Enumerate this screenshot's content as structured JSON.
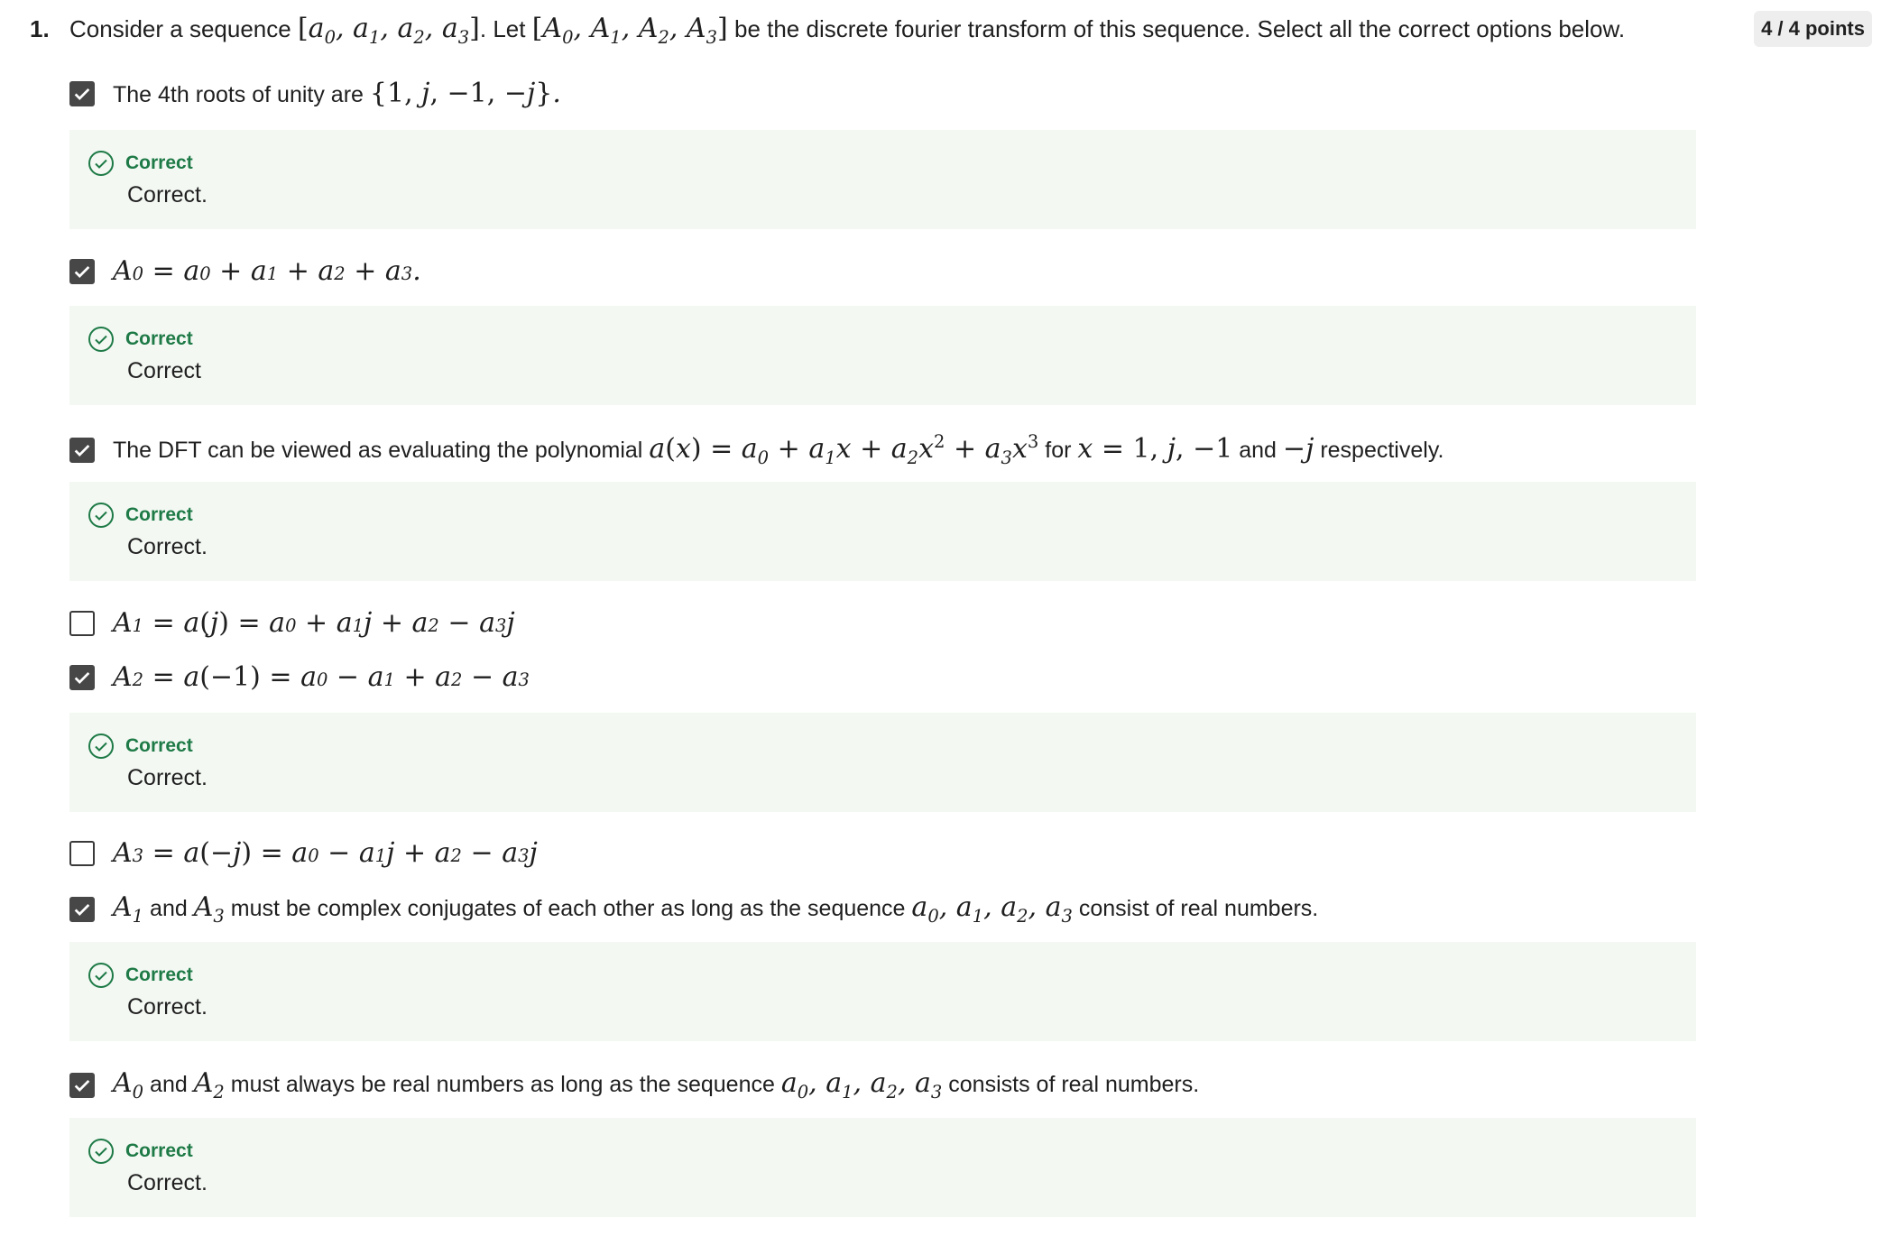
{
  "question": {
    "number": "1.",
    "intro": "Consider a sequence",
    "seq": "[a0, a1, a2, a3]",
    "mid": ". Let",
    "dft": "[A0, A1, A2, A3]",
    "tail": "be the discrete fourier transform of this sequence. Select all the correct options below."
  },
  "points": "4 / 4 points",
  "options": [
    {
      "text": "The 4th roots of unity are",
      "math": "{1, j, −1, −j}.",
      "checked": true
    },
    {
      "math": "A0 = a0 + a1 + a2 + a3.",
      "checked": true
    },
    {
      "text": "The DFT can be viewed as evaluating the polynomial",
      "math": "a(x) = a0 + a1x + a2x² + a3x³",
      "text2": "for",
      "math2": "x = 1, j, −1",
      "text3": "and",
      "math3": "−j",
      "text4": "respectively.",
      "checked": true
    },
    {
      "math": "A1 = a(j) = a0 + a1j + a2 − a3j",
      "checked": false
    },
    {
      "math": "A2 = a(−1) = a0 − a1 + a2 − a3",
      "checked": true
    },
    {
      "math": "A3 = a(−j) = a0 − a1j + a2 − a3j",
      "checked": false
    },
    {
      "math": "A1",
      "text": "and",
      "math2": "A3",
      "text2": "must be complex conjugates of each other as long as the sequence",
      "math3": "a0, a1, a2, a3",
      "text3": "consist of real numbers.",
      "checked": true
    },
    {
      "math": "A0",
      "text": "and",
      "math2": "A2",
      "text2": "must always be real numbers as long as the sequence",
      "math3": "a0, a1, a2, a3",
      "text3": "consists of real numbers.",
      "checked": true
    }
  ],
  "feedback": [
    {
      "title": "Correct",
      "message": "Correct."
    },
    {
      "title": "Correct",
      "message": "Correct"
    },
    {
      "title": "Correct",
      "message": "Correct."
    },
    {
      "title": "Correct",
      "message": "Correct."
    },
    {
      "title": "Correct",
      "message": "Correct."
    },
    {
      "title": "Correct",
      "message": "Correct."
    }
  ],
  "colors": {
    "correct_green": "#1e7a46",
    "feedback_bg": "#f3f8f3",
    "checkbox_fill": "#474747",
    "badge_bg": "#eeeeee"
  },
  "icons": {
    "checkbox_checked": "check-icon",
    "feedback": "circle-check-icon"
  }
}
